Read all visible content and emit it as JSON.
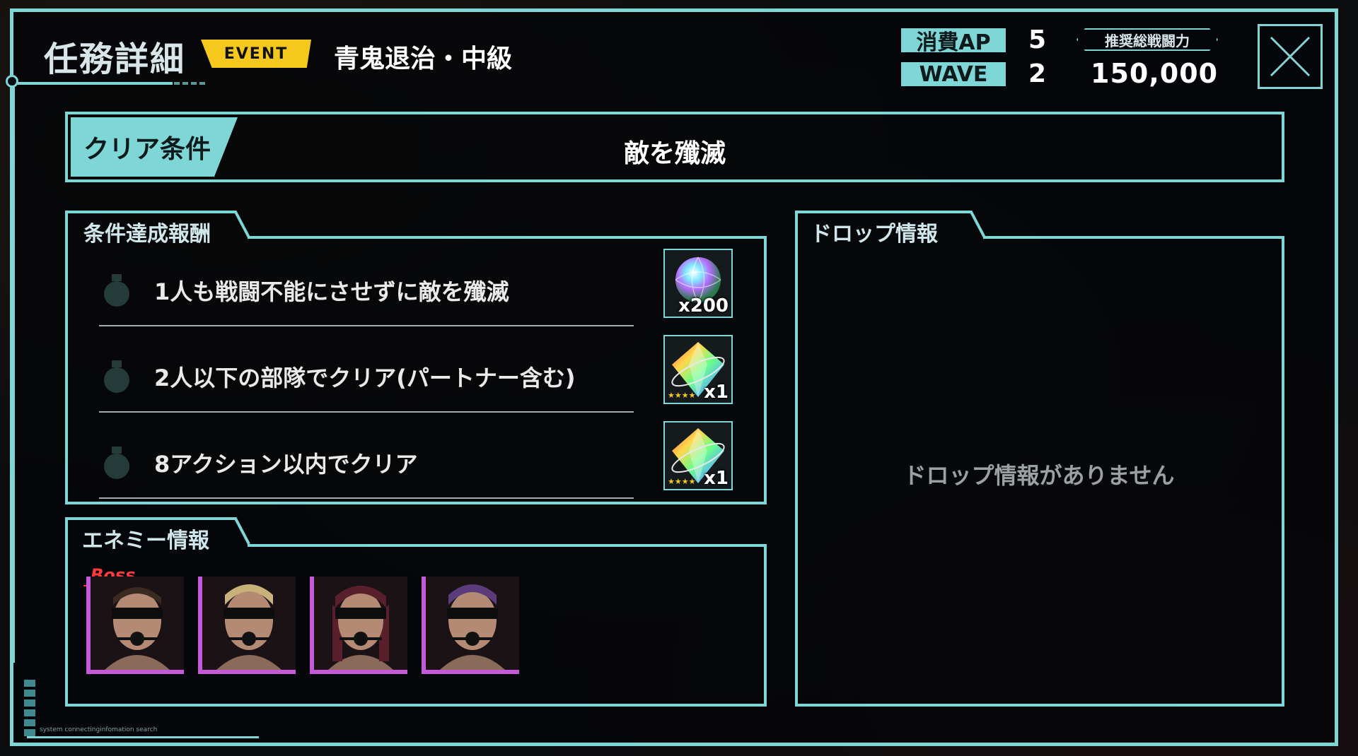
{
  "header": {
    "title": "任務詳細",
    "event_badge": "EVENT",
    "quest_name": "青鬼退治・中級",
    "ap_label": "消費AP",
    "ap_value": "5",
    "wave_label": "WAVE",
    "wave_value": "2",
    "power_label": "推奨総戦闘力",
    "power_value": "150,000"
  },
  "clear_condition": {
    "label": "クリア条件",
    "text": "敵を殲滅"
  },
  "rewards": {
    "title": "条件達成報酬",
    "items": [
      {
        "text": "1人も戦闘不能にさせずに敵を殲滅",
        "reward_qty": "x200",
        "reward_icon": "rainbow-orb-icon"
      },
      {
        "text": "2人以下の部隊でクリア(パートナー含む)",
        "reward_qty": "x1",
        "reward_icon": "rainbow-crystal-icon",
        "stars": "★★★★"
      },
      {
        "text": "8アクション以内でクリア",
        "reward_qty": "x1",
        "reward_icon": "rainbow-crystal-icon",
        "stars": "★★★★"
      }
    ]
  },
  "enemies": {
    "title": "エネミー情報",
    "boss_label": "Boss",
    "list": [
      {
        "name": "enemy-1",
        "hair": "#3a2a22",
        "boss": true
      },
      {
        "name": "enemy-2",
        "hair": "#c9b27a",
        "boss": false
      },
      {
        "name": "enemy-3",
        "hair": "#5a1f2c",
        "boss": false
      },
      {
        "name": "enemy-4",
        "hair": "#5b3b7a",
        "boss": false
      }
    ]
  },
  "drops": {
    "title": "ドロップ情報",
    "empty_text": "ドロップ情報がありません"
  },
  "footer": {
    "status_text": "system connectinginfomation search"
  },
  "colors": {
    "accent": "#7fd6d6",
    "event": "#f4c81c",
    "enemy_border": "#c45ad8",
    "boss": "#ff3b3b"
  }
}
